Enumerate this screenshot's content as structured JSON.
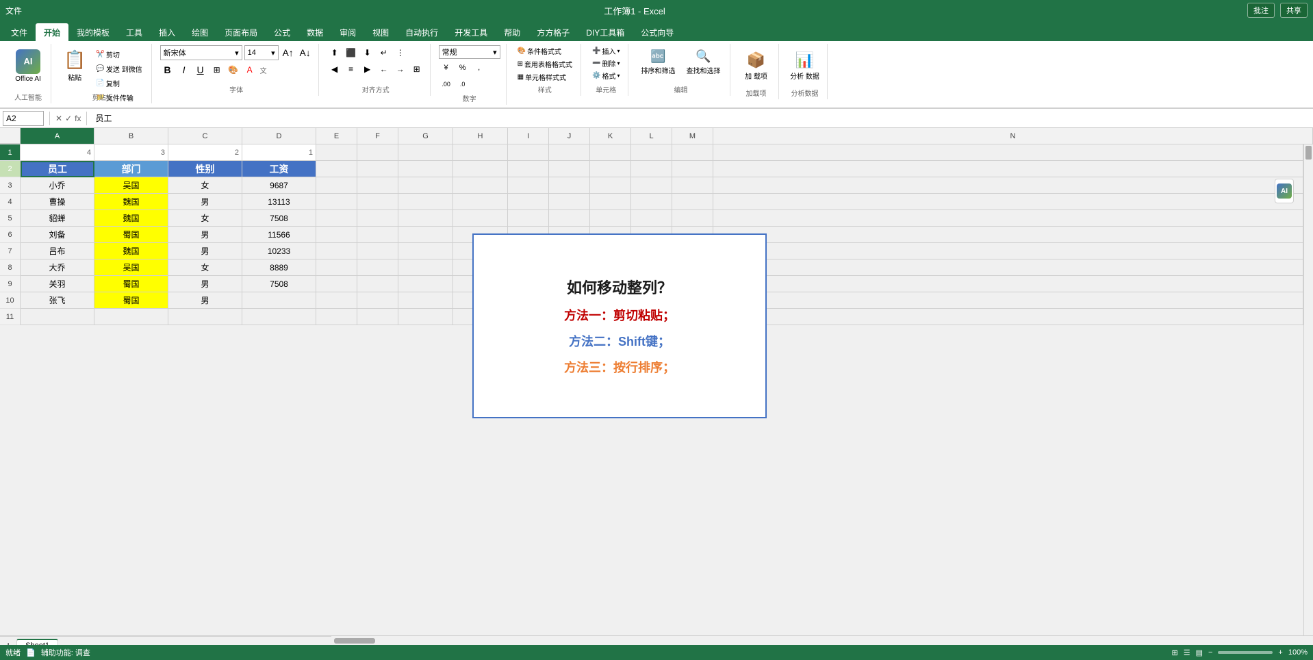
{
  "app": {
    "title": "工作簿1 - Excel"
  },
  "titlebar": {
    "left_items": [
      "文件",
      "开始",
      "我的模板",
      "工具",
      "插入",
      "绘图",
      "页面布局",
      "公式",
      "数据",
      "审阅",
      "视图",
      "自动执行",
      "开发工具",
      "帮助",
      "方方格子",
      "DIY工具箱",
      "公式向导"
    ],
    "comment_label": "批注",
    "share_label": "共享"
  },
  "ribbon": {
    "active_tab": "开始",
    "tabs": [
      "文件",
      "开始",
      "我的模板",
      "工具",
      "插入",
      "绘图",
      "页面布局",
      "公式",
      "数据",
      "审阅",
      "视图",
      "自动执行",
      "开发工具",
      "帮助",
      "方方格子",
      "DIY工具箱",
      "公式向导"
    ],
    "groups": {
      "ai": {
        "label": "人工智能",
        "btn_label": "Office\nAI"
      },
      "clipboard": {
        "label": "剪贴板",
        "paste": "粘贴",
        "cut": "剪切",
        "copy": "复制",
        "format_painter": "格式刷",
        "send_wechat": "发送\n到微信",
        "file_transfer": "文件传输"
      },
      "font": {
        "label": "字体",
        "font_name": "新宋体",
        "font_size": "14",
        "bold": "B",
        "italic": "I",
        "underline": "U",
        "border": "⊞",
        "fill_color": "A",
        "font_color": "A",
        "grow": "A↑",
        "shrink": "A↓"
      },
      "alignment": {
        "label": "对齐方式",
        "btns": [
          "≡",
          "≡",
          "≡",
          "↵",
          "⋮",
          "←",
          "≡",
          "→",
          "←→",
          "↕",
          "⊞",
          "缩进↑",
          "缩进↓"
        ]
      },
      "number": {
        "label": "数字",
        "format": "常规",
        "percent": "%",
        "comma": ",",
        "currency": "¥",
        "increase_decimal": ".00",
        "decrease_decimal": ".0"
      },
      "styles": {
        "label": "样式",
        "conditional": "条件格式式",
        "table_format": "套用表格格式式",
        "cell_styles": "单元格样式式"
      },
      "cells": {
        "label": "单元格",
        "insert": "插入",
        "delete": "删除",
        "format": "格式"
      },
      "editing": {
        "label": "编辑",
        "sum": "Σ",
        "fill": "↓",
        "clear": "✕",
        "sort_filter": "排序和筛选",
        "find_select": "查找和选择"
      },
      "addins": {
        "label": "加载项",
        "add_addin": "加\n载项"
      },
      "analyze": {
        "label": "分析数据",
        "analyze_btn": "分析\n数据"
      }
    }
  },
  "formula_bar": {
    "cell_ref": "A2",
    "formula": "员工"
  },
  "columns": {
    "headers": [
      "A",
      "B",
      "C",
      "D",
      "E",
      "F",
      "G",
      "H",
      "I",
      "J",
      "K",
      "L",
      "M",
      "N"
    ],
    "col_numbers_row1": {
      "A": "4",
      "B": "3",
      "C": "2",
      "D": "1"
    }
  },
  "spreadsheet": {
    "rows": [
      {
        "row": 1,
        "A": "4",
        "B": "3",
        "C": "2",
        "D": "1",
        "E": "",
        "F": "",
        "G": "",
        "H": ""
      },
      {
        "row": 2,
        "A": "员工",
        "B": "部门",
        "C": "性别",
        "D": "工资",
        "E": "",
        "F": "",
        "G": "",
        "H": ""
      },
      {
        "row": 3,
        "A": "小乔",
        "B": "吴国",
        "C": "女",
        "D": "9687",
        "E": "",
        "F": "",
        "G": "",
        "H": ""
      },
      {
        "row": 4,
        "A": "曹操",
        "B": "魏国",
        "C": "男",
        "D": "13113",
        "E": "",
        "F": "",
        "G": "",
        "H": ""
      },
      {
        "row": 5,
        "A": "貂蝉",
        "B": "魏国",
        "C": "女",
        "D": "7508",
        "E": "",
        "F": "",
        "G": "",
        "H": ""
      },
      {
        "row": 6,
        "A": "刘备",
        "B": "蜀国",
        "C": "男",
        "D": "11566",
        "E": "",
        "F": "",
        "G": "",
        "H": ""
      },
      {
        "row": 7,
        "A": "吕布",
        "B": "魏国",
        "C": "男",
        "D": "10233",
        "E": "",
        "F": "",
        "G": "",
        "H": ""
      },
      {
        "row": 8,
        "A": "大乔",
        "B": "吴国",
        "C": "女",
        "D": "8889",
        "E": "",
        "F": "",
        "G": "",
        "H": ""
      },
      {
        "row": 9,
        "A": "关羽",
        "B": "蜀国",
        "C": "男",
        "D": "7508",
        "E": "",
        "F": "",
        "G": "",
        "H": ""
      },
      {
        "row": 10,
        "A": "张飞",
        "B": "蜀国",
        "C": "男",
        "D": "",
        "E": "",
        "F": "",
        "G": "",
        "H": ""
      }
    ]
  },
  "textbox": {
    "title": "如何移动整列？",
    "method1": "方法一：剪切粘贴；",
    "method2": "方法二：Shift键；",
    "method3": "方法三：按行排序；"
  },
  "sheet_tabs": [
    "Sheet1"
  ],
  "status_bar": {
    "left": "就绪",
    "icons": [
      "📄",
      "📊",
      "🔧"
    ],
    "helper": "辅助功能: 调查",
    "right_icons": [
      "⊞",
      "☰",
      "▤"
    ],
    "zoom": "100%"
  }
}
